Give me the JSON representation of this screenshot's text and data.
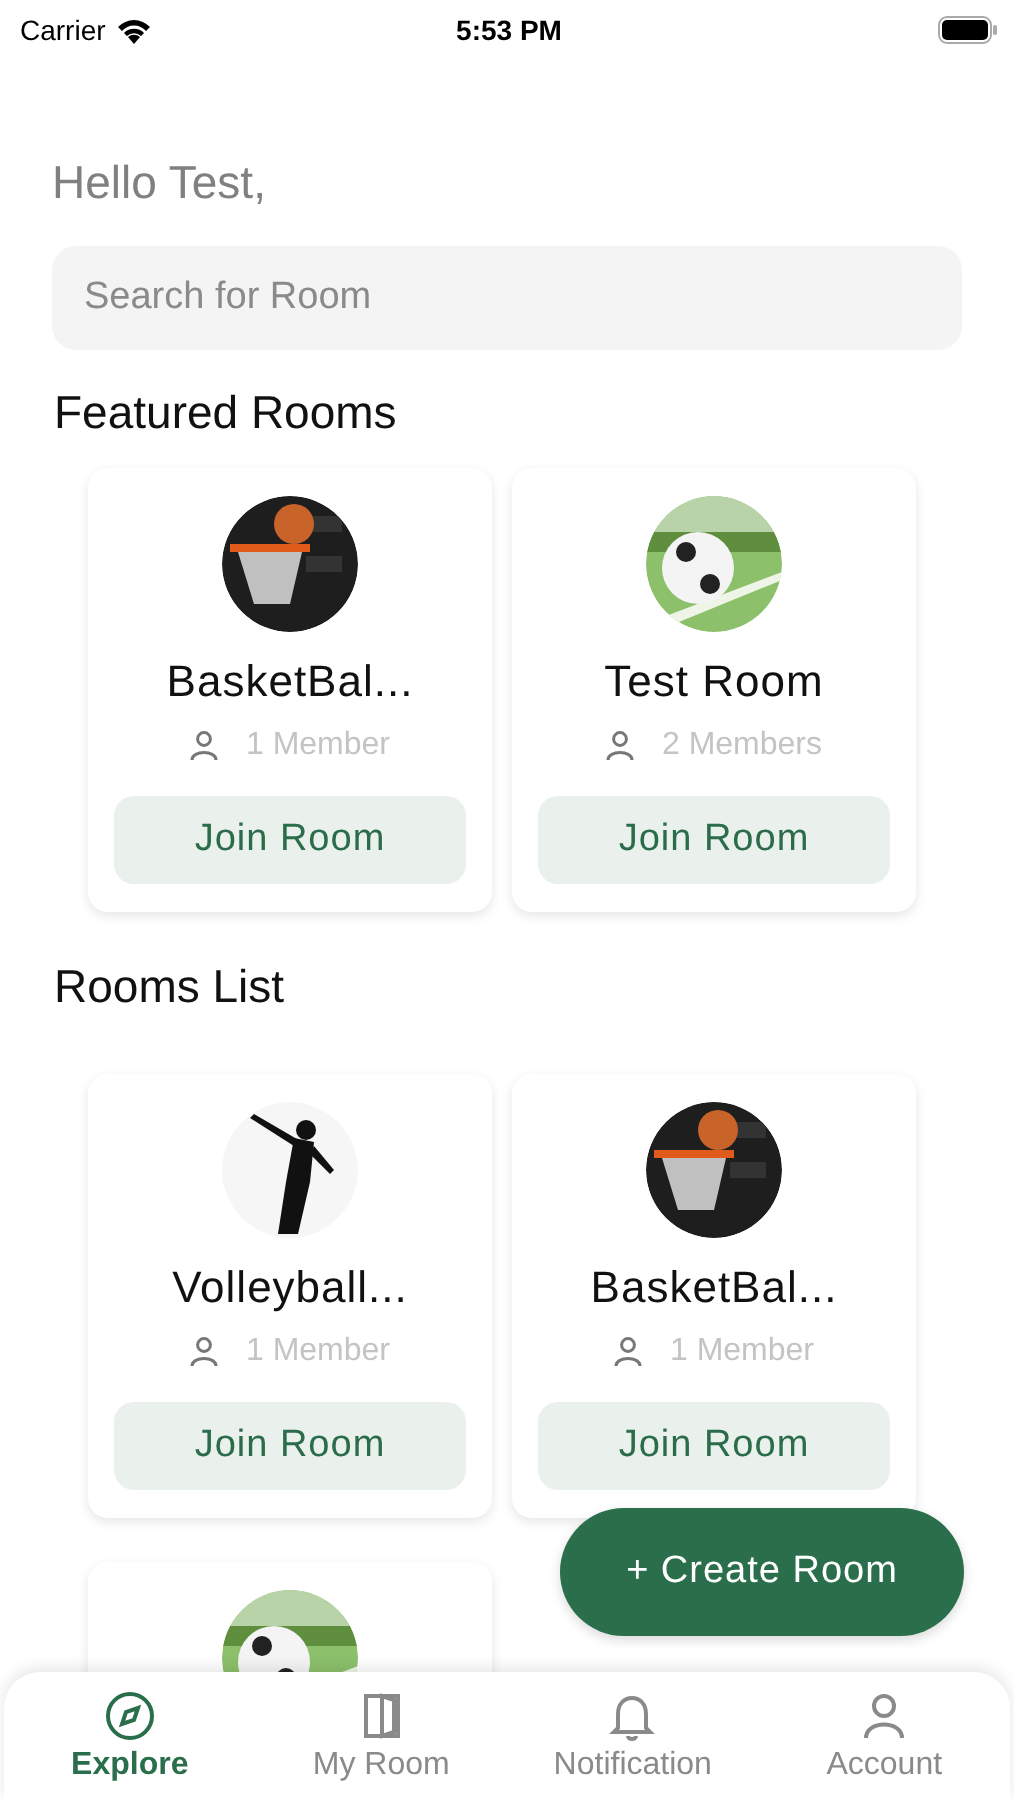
{
  "status_bar": {
    "carrier": "Carrier",
    "time": "5:53 PM"
  },
  "greeting": "Hello Test,",
  "search": {
    "placeholder": "Search for Room"
  },
  "featured": {
    "title": "Featured Rooms",
    "rooms": [
      {
        "kind": "room",
        "name": "BasketBal...",
        "members": "1 Member",
        "button": "Join Room"
      },
      {
        "kind": "room",
        "name": "Test Room",
        "members": "2 Members",
        "button": "Join Room"
      }
    ]
  },
  "rooms_list": {
    "title": "Rooms List",
    "rooms": [
      {
        "kind": "room",
        "name": "Volleyball...",
        "members": "1 Member",
        "button": "Join Room"
      },
      {
        "kind": "room",
        "name": "BasketBal...",
        "members": "1 Member",
        "button": "Join Room"
      },
      {
        "kind": "picture"
      }
    ]
  },
  "create_button": "+ Create Room",
  "tabs": [
    {
      "label": "Explore",
      "selected": true
    },
    {
      "label": "My Room",
      "selected": false
    },
    {
      "label": "Notification",
      "selected": false
    },
    {
      "label": "Account",
      "selected": false
    }
  ]
}
